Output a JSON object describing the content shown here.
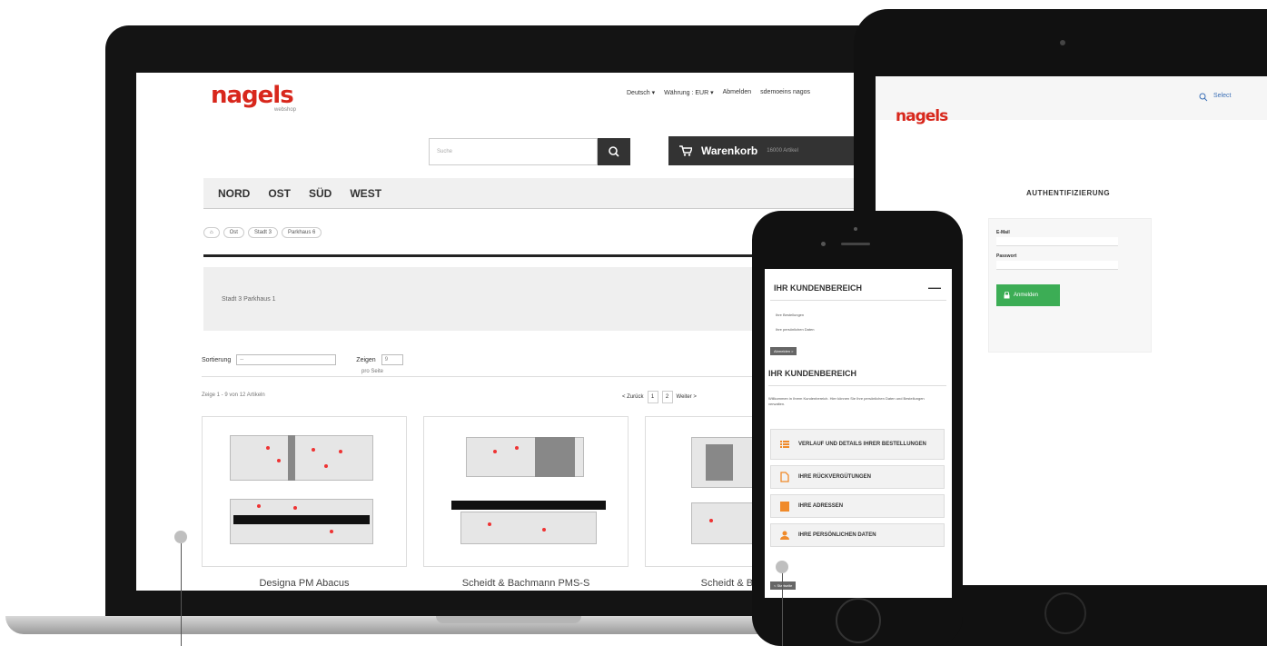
{
  "laptop": {
    "logo": "nagels",
    "logo_sub": "webshop",
    "nav": {
      "language": "Deutsch ▾",
      "currency": "Währung : EUR ▾",
      "logout": "Abmelden",
      "user": "sdemoeins nagos"
    },
    "search": {
      "placeholder": "Suche"
    },
    "cart": {
      "label": "Warenkorb",
      "count": "16000 Artikel"
    },
    "menu": [
      "NORD",
      "OST",
      "SÜD",
      "WEST"
    ],
    "breadcrumb": [
      "Ost",
      "Stadt 3",
      "Parkhaus 6"
    ],
    "info_text": "Stadt 3 Parkhaus 1",
    "sort": {
      "label": "Sortierung",
      "value": "--",
      "show_label": "Zeigen",
      "show_value": "9",
      "per_page": "pro Seite"
    },
    "count_text": "Zeige 1 - 9 von 12 Artikeln",
    "pager": {
      "prev": "< Zurück",
      "pages": [
        "1",
        "2"
      ],
      "next": "Weiter >"
    },
    "products": [
      {
        "name": "Designa PM Abacus"
      },
      {
        "name": "Scheidt & Bachmann PMS-S"
      },
      {
        "name": "Scheidt & Bachmann"
      }
    ]
  },
  "tablet": {
    "logo": "nagels",
    "top_links": [
      "Select"
    ],
    "auth_title": "AUTHENTIFIZIERUNG",
    "email_label": "E-Mail",
    "password_label": "Passwort",
    "login_button": "Anmelden"
  },
  "phone": {
    "section_title": "IHR KUNDENBEREICH",
    "collapse_icon": "—",
    "links": [
      "Ihre Bestellungen",
      "Ihre persönlichen Daten"
    ],
    "logout_button": "Abmelden >",
    "heading": "IHR KUNDENBEREICH",
    "welcome": "Willkommen in Ihrem Kundenbereich. Hier können Sie Ihre persönlichen Daten und Bestellungen verwalten.",
    "menu_items": [
      {
        "label": "VERLAUF UND DETAILS IHRER BESTELLUNGEN",
        "icon": "list-icon"
      },
      {
        "label": "IHRE RÜCKVERGÜTUNGEN",
        "icon": "document-icon"
      },
      {
        "label": "IHRE ADRESSEN",
        "icon": "address-book-icon"
      },
      {
        "label": "IHRE PERSÖNLICHEN DATEN",
        "icon": "user-icon"
      }
    ],
    "back_button": "< Startseite"
  }
}
